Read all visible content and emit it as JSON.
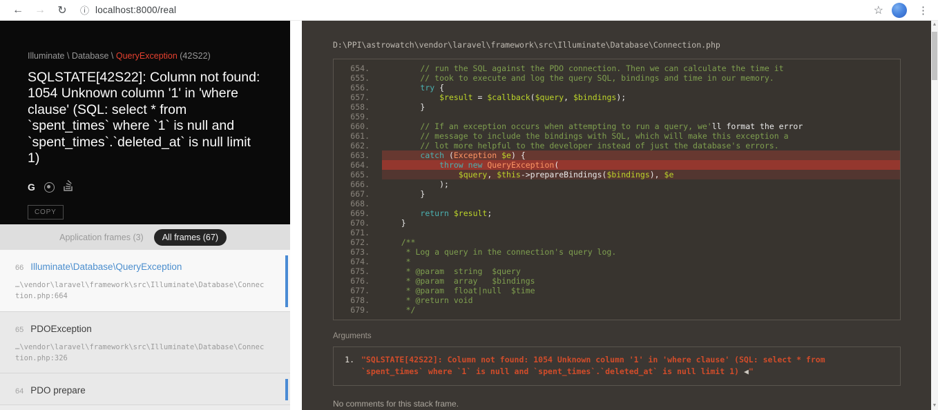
{
  "colors": {
    "accent_red": "#e5412f",
    "frame_active_blue": "#4b8ece",
    "argument_red": "#d14c2a",
    "code_comment": "#7f9f4f",
    "code_keyword": "#4bb1b1",
    "code_variable": "#bcd42a",
    "code_type": "#fc9463"
  },
  "browser": {
    "url": "localhost:8000/real"
  },
  "exception": {
    "namespace": "Illuminate \\ Database \\ ",
    "class": "QueryException",
    "code": " (42S22)",
    "message": "SQLSTATE[42S22]: Column not found: 1054 Unknown column '1' in 'where clause' (SQL: select * from `spent_times` where `1` is null and `spent_times`.`deleted_at` is null limit 1)",
    "copy_label": "COPY"
  },
  "frames_panel": {
    "tabs": [
      {
        "label": "Application frames (3)",
        "active": false
      },
      {
        "label": "All frames (67)",
        "active": true
      }
    ],
    "frames": [
      {
        "index": "66",
        "title": "Illuminate\\Database\\QueryException",
        "path": "…\\vendor\\laravel\\framework\\src\\Illuminate\\Database\\Connection.php",
        "line": ":664",
        "active": true,
        "indicator": true
      },
      {
        "index": "65",
        "title": "PDOException",
        "path": "…\\vendor\\laravel\\framework\\src\\Illuminate\\Database\\Connection.php",
        "line": ":326",
        "active": false,
        "indicator": false
      },
      {
        "index": "64",
        "title": "PDO prepare",
        "path": "",
        "line": "",
        "active": false,
        "indicator": true
      }
    ]
  },
  "details": {
    "file_path": "D:\\PPI\\astrowatch\\vendor\\laravel\\framework\\src\\Illuminate\\Database\\Connection.php",
    "arguments_label": "Arguments",
    "argument": {
      "num": "1.",
      "text": "\"SQLSTATE[42S22]: Column not found: 1054 Unknown column '1' in 'where clause' (SQL: select * from `spent_times` where `1` is null and `spent_times`.`deleted_at` is null limit 1) ",
      "marker": "◀",
      "close": "\""
    },
    "no_comments": "No comments for this stack frame."
  },
  "code": {
    "lines": [
      {
        "n": "654.",
        "hl": 0,
        "t": [
          [
            "c",
            "        // run the SQL against the PDO connection. Then we can calculate the time it"
          ]
        ]
      },
      {
        "n": "655.",
        "hl": 0,
        "t": [
          [
            "c",
            "        // took to execute and log the query SQL, bindings and time in our memory."
          ]
        ]
      },
      {
        "n": "656.",
        "hl": 0,
        "t": [
          [
            "p",
            "        "
          ],
          [
            "k",
            "try"
          ],
          [
            "p",
            " {"
          ]
        ]
      },
      {
        "n": "657.",
        "hl": 0,
        "t": [
          [
            "p",
            "            "
          ],
          [
            "v",
            "$result"
          ],
          [
            "p",
            " = "
          ],
          [
            "v",
            "$callback"
          ],
          [
            "p",
            "("
          ],
          [
            "v",
            "$query"
          ],
          [
            "p",
            ", "
          ],
          [
            "v",
            "$bindings"
          ],
          [
            "p",
            ");"
          ]
        ]
      },
      {
        "n": "658.",
        "hl": 0,
        "t": [
          [
            "p",
            "        }"
          ]
        ]
      },
      {
        "n": "659.",
        "hl": 0,
        "t": []
      },
      {
        "n": "660.",
        "hl": 0,
        "t": [
          [
            "c",
            "        // If an exception occurs when attempting to run a query, we'"
          ],
          [
            "p",
            "ll format the error"
          ]
        ]
      },
      {
        "n": "661.",
        "hl": 0,
        "t": [
          [
            "c",
            "        // message to include the bindings with SQL, which will make this exception a"
          ]
        ]
      },
      {
        "n": "662.",
        "hl": 0,
        "t": [
          [
            "c",
            "        // lot more helpful to the developer instead of just the database's errors."
          ]
        ]
      },
      {
        "n": "663.",
        "hl": 1,
        "t": [
          [
            "p",
            "        "
          ],
          [
            "k",
            "catch"
          ],
          [
            "p",
            " ("
          ],
          [
            "t",
            "Exception"
          ],
          [
            "p",
            " "
          ],
          [
            "v",
            "$e"
          ],
          [
            "p",
            ") {"
          ]
        ]
      },
      {
        "n": "664.",
        "hl": 2,
        "t": [
          [
            "p",
            "            "
          ],
          [
            "k",
            "throw"
          ],
          [
            "p",
            " "
          ],
          [
            "k",
            "new"
          ],
          [
            "p",
            " "
          ],
          [
            "t",
            "QueryException"
          ],
          [
            "p",
            "("
          ]
        ]
      },
      {
        "n": "665.",
        "hl": 3,
        "t": [
          [
            "p",
            "                "
          ],
          [
            "v",
            "$query"
          ],
          [
            "p",
            ", "
          ],
          [
            "v",
            "$this"
          ],
          [
            "p",
            "->prepareBindings("
          ],
          [
            "v",
            "$bindings"
          ],
          [
            "p",
            "), "
          ],
          [
            "v",
            "$e"
          ]
        ]
      },
      {
        "n": "666.",
        "hl": 0,
        "t": [
          [
            "p",
            "            );"
          ]
        ]
      },
      {
        "n": "667.",
        "hl": 0,
        "t": [
          [
            "p",
            "        }"
          ]
        ]
      },
      {
        "n": "668.",
        "hl": 0,
        "t": []
      },
      {
        "n": "669.",
        "hl": 0,
        "t": [
          [
            "p",
            "        "
          ],
          [
            "k",
            "return"
          ],
          [
            "p",
            " "
          ],
          [
            "v",
            "$result"
          ],
          [
            "p",
            ";"
          ]
        ]
      },
      {
        "n": "670.",
        "hl": 0,
        "t": [
          [
            "p",
            "    }"
          ]
        ]
      },
      {
        "n": "671.",
        "hl": 0,
        "t": []
      },
      {
        "n": "672.",
        "hl": 0,
        "t": [
          [
            "c",
            "    /**"
          ]
        ]
      },
      {
        "n": "673.",
        "hl": 0,
        "t": [
          [
            "c",
            "     * Log a query in the connection's query log."
          ]
        ]
      },
      {
        "n": "674.",
        "hl": 0,
        "t": [
          [
            "c",
            "     *"
          ]
        ]
      },
      {
        "n": "675.",
        "hl": 0,
        "t": [
          [
            "c",
            "     * @param  string  $query"
          ]
        ]
      },
      {
        "n": "676.",
        "hl": 0,
        "t": [
          [
            "c",
            "     * @param  array   $bindings"
          ]
        ]
      },
      {
        "n": "677.",
        "hl": 0,
        "t": [
          [
            "c",
            "     * @param  float|null  $time"
          ]
        ]
      },
      {
        "n": "678.",
        "hl": 0,
        "t": [
          [
            "c",
            "     * @return void"
          ]
        ]
      },
      {
        "n": "679.",
        "hl": 0,
        "t": [
          [
            "c",
            "     */"
          ]
        ]
      }
    ]
  }
}
